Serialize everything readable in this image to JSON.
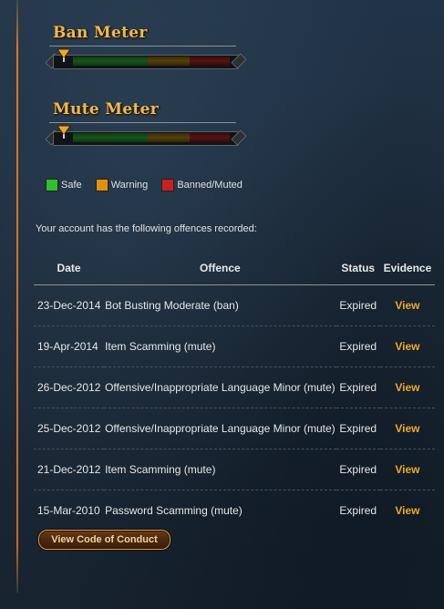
{
  "meters": [
    {
      "title": "Ban Meter",
      "level_percent": 0
    },
    {
      "title": "Mute Meter",
      "level_percent": 0
    }
  ],
  "legend": [
    {
      "label": "Safe",
      "color": "#2fbf2f"
    },
    {
      "label": "Warning",
      "color": "#e0900f"
    },
    {
      "label": "Banned/Muted",
      "color": "#cc1f1f"
    }
  ],
  "intro": "Your account has the following offences recorded:",
  "table": {
    "headers": {
      "date": "Date",
      "offence": "Offence",
      "status": "Status",
      "evidence": "Evidence"
    },
    "rows": [
      {
        "date": "23-Dec-2014",
        "offence": "Bot Busting Moderate (ban)",
        "status": "Expired",
        "evidence": "View"
      },
      {
        "date": "19-Apr-2014",
        "offence": "Item Scamming (mute)",
        "status": "Expired",
        "evidence": "View"
      },
      {
        "date": "26-Dec-2012",
        "offence": "Offensive/Inappropriate Language Minor (mute)",
        "status": "Expired",
        "evidence": "View"
      },
      {
        "date": "25-Dec-2012",
        "offence": "Offensive/Inappropriate Language Minor (mute)",
        "status": "Expired",
        "evidence": "View"
      },
      {
        "date": "21-Dec-2012",
        "offence": "Item Scamming (mute)",
        "status": "Expired",
        "evidence": "View"
      },
      {
        "date": "15-Mar-2010",
        "offence": "Password Scamming (mute)",
        "status": "Expired",
        "evidence": "View"
      }
    ]
  },
  "code_of_conduct_button": "View Code of Conduct",
  "colors": {
    "accent": "#f0a922",
    "title": "#f2b84b",
    "background": "#1d2c3c"
  }
}
